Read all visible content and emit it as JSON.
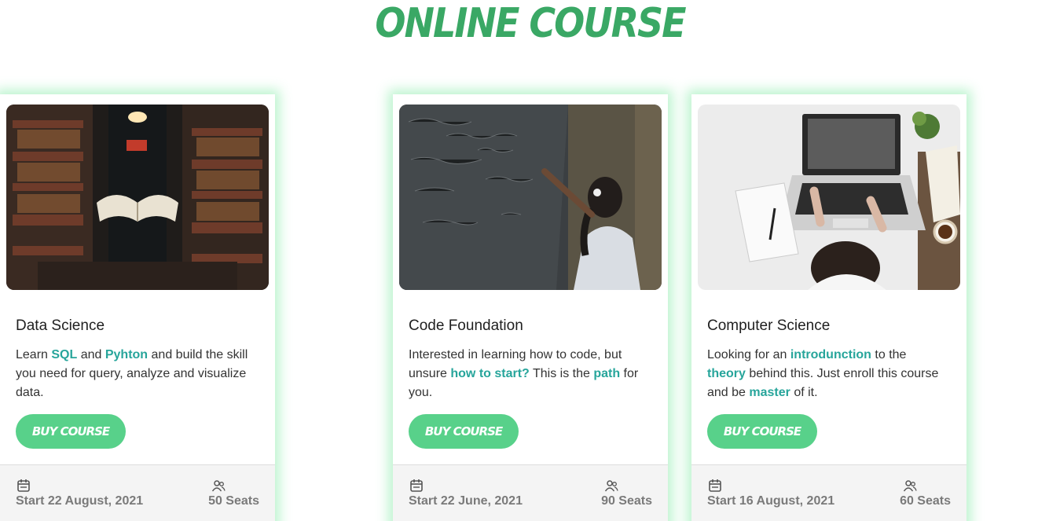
{
  "page": {
    "title": "ONLINE COURSE"
  },
  "cards": [
    {
      "title": "Code Foundation",
      "desc": [
        {
          "t": "Interested in learning how to code, but unsure ",
          "hl": false
        },
        {
          "t": "how to start?",
          "hl": true
        },
        {
          "t": " This is the ",
          "hl": false
        },
        {
          "t": "path",
          "hl": true
        },
        {
          "t": " for you.",
          "hl": false
        }
      ],
      "button": "BUY COURSE",
      "start": "Start 22 June, 2021",
      "seats": "90 Seats"
    },
    {
      "title": "Computer Science",
      "desc": [
        {
          "t": "Looking for an ",
          "hl": false
        },
        {
          "t": "introdunction",
          "hl": true
        },
        {
          "t": " to the ",
          "hl": false
        },
        {
          "t": "theory",
          "hl": true
        },
        {
          "t": " behind this. Just enroll this course and be ",
          "hl": false
        },
        {
          "t": "master",
          "hl": true
        },
        {
          "t": " of it.",
          "hl": false
        }
      ],
      "button": "BUY COURSE",
      "start": "Start 16 August, 2021",
      "seats": "60 Seats"
    },
    {
      "title": "Data Science",
      "desc": [
        {
          "t": "Learn ",
          "hl": false
        },
        {
          "t": "SQL",
          "hl": true
        },
        {
          "t": " and ",
          "hl": false
        },
        {
          "t": "Pyhton",
          "hl": true
        },
        {
          "t": " and build the skill you need for query, analyze and visualize data.",
          "hl": false
        }
      ],
      "button": "BUY COURSE",
      "start": "Start 22 August, 2021",
      "seats": "50 Seats"
    }
  ],
  "colors": {
    "accent": "#3aa865",
    "button": "#58d18a",
    "highlight": "#27a59b"
  },
  "icons": {
    "date": "calendar-icon",
    "seats": "users-icon"
  }
}
